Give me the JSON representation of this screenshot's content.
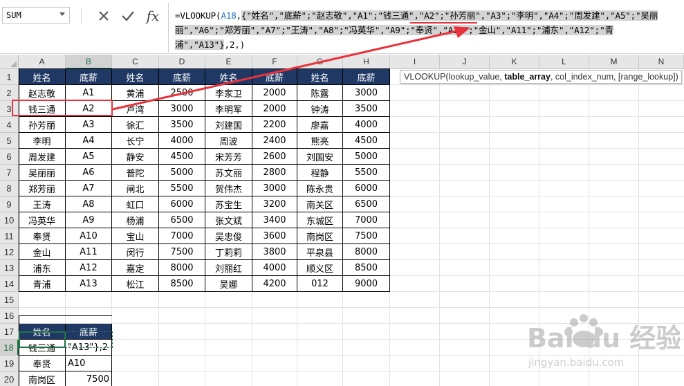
{
  "formula_bar": {
    "name_box": "SUM",
    "cancel_icon": "cancel-icon",
    "enter_icon": "enter-icon",
    "fx_label": "fx",
    "formula": {
      "prefix": "=VLOOKUP(",
      "ref": "A18",
      "comma": ",",
      "array": "{\"姓名\",\"底薪\";\"赵志敬\",\"A1\";\"钱三通\",\"A2\";\"孙芳丽\",\"A3\";\"李明\",\"A4\";\"周发建\",\"A5\";\"吴丽丽\",\"A6\";\"郑芳丽\",\"A7\";\"王涛\",\"A8\";\"冯英华\",\"A9\";\"奉贤\",\"A10\";\"金山\",\"A11\";\"浦东\",\"A12\";\"青浦\",\"A13\"}",
      "suffix": ",2,)"
    }
  },
  "tooltip": {
    "func": "VLOOKUP(",
    "arg1": "lookup_value, ",
    "arg2_bold": "table_array",
    "arg3": ", col_index_num, [range_lookup])"
  },
  "columns": [
    "A",
    "B",
    "C",
    "D",
    "E",
    "F",
    "G",
    "H",
    "I",
    "J",
    "K",
    "L",
    "M",
    "N"
  ],
  "rows": [
    "1",
    "2",
    "3",
    "4",
    "5",
    "6",
    "7",
    "8",
    "9",
    "10",
    "11",
    "12",
    "13",
    "14",
    "15",
    "16",
    "17",
    "18",
    "19",
    "20"
  ],
  "table": {
    "header": [
      "姓名",
      "底薪",
      "姓名",
      "底薪",
      "姓名",
      "底薪",
      "姓名",
      "底薪"
    ],
    "rows": [
      [
        "赵志敬",
        "A1",
        "黄浦",
        "2500",
        "李家卫",
        "2000",
        "陈露",
        "3000"
      ],
      [
        "钱三通",
        "A2",
        "卢湾",
        "3000",
        "李明军",
        "2000",
        "钟涛",
        "3500"
      ],
      [
        "孙芳丽",
        "A3",
        "徐汇",
        "3500",
        "刘建国",
        "2200",
        "廖嘉",
        "4000"
      ],
      [
        "李明",
        "A4",
        "长宁",
        "4000",
        "周波",
        "2400",
        "熊亮",
        "4500"
      ],
      [
        "周发建",
        "A5",
        "静安",
        "4500",
        "宋芳芳",
        "2600",
        "刘国安",
        "5000"
      ],
      [
        "吴丽丽",
        "A6",
        "普陀",
        "5000",
        "苏文丽",
        "2800",
        "程静",
        "5500"
      ],
      [
        "郑芳丽",
        "A7",
        "闸北",
        "5500",
        "贺伟杰",
        "3000",
        "陈永贵",
        "6000"
      ],
      [
        "王涛",
        "A8",
        "虹口",
        "6000",
        "苏宝生",
        "3200",
        "南关区",
        "6500"
      ],
      [
        "冯英华",
        "A9",
        "杨浦",
        "6500",
        "张文斌",
        "3400",
        "东城区",
        "7000"
      ],
      [
        "奉贤",
        "A10",
        "宝山",
        "7000",
        "吴忠俊",
        "3600",
        "南岗区",
        "7500"
      ],
      [
        "金山",
        "A11",
        "闵行",
        "7500",
        "丁莉莉",
        "3800",
        "平泉县",
        "8000"
      ],
      [
        "浦东",
        "A12",
        "嘉定",
        "8000",
        "刘丽红",
        "4000",
        "顺义区",
        "8500"
      ],
      [
        "青浦",
        "A13",
        "松江",
        "8500",
        "吴娜",
        "4200",
        "012",
        "9000"
      ]
    ]
  },
  "table2": {
    "header": [
      "姓名",
      "底薪"
    ],
    "rows": [
      [
        "钱三通",
        "\"A13\"},2"
      ],
      [
        "奉贤",
        "A10"
      ],
      [
        "南岗区",
        "7500"
      ]
    ]
  },
  "watermark": {
    "brand": "Bai du 经验",
    "url": "jingyan.baidu.com"
  },
  "colors": {
    "header_fill": "#1f3864",
    "accent_green": "#217346",
    "annotation_red": "#e8323c",
    "ref_blue": "#1f6fc5"
  }
}
